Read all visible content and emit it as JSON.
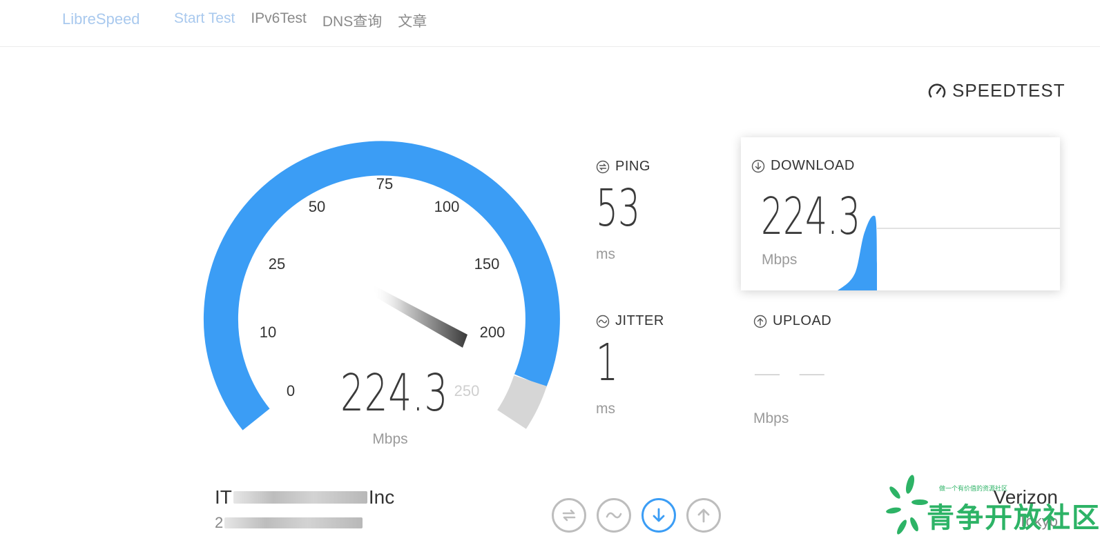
{
  "nav": {
    "brand": "LibreSpeed",
    "links": [
      "Start Test",
      "IPv6Test",
      "DNS查询",
      "文章"
    ]
  },
  "logo": {
    "text": "SPEEDTEST",
    "icon": "gauge-icon"
  },
  "gauge": {
    "value": "224.3",
    "unit": "Mbps",
    "scale_labels": [
      "0",
      "10",
      "25",
      "50",
      "75",
      "100",
      "150",
      "200",
      "250"
    ],
    "needle_at": "200",
    "arc_color": "#3b9df5",
    "remaining_color": "#d6d6d6"
  },
  "ping": {
    "label": "PING",
    "value": "53",
    "unit": "ms",
    "icon": "ping-icon"
  },
  "jitter": {
    "label": "JITTER",
    "value": "1",
    "unit": "ms",
    "icon": "jitter-icon"
  },
  "download": {
    "label": "DOWNLOAD",
    "value": "224.3",
    "unit": "Mbps",
    "icon": "download-arrow-icon"
  },
  "upload": {
    "label": "UPLOAD",
    "value": "— —",
    "unit": "Mbps",
    "icon": "upload-arrow-icon"
  },
  "isp": {
    "name_prefix": "IT",
    "name_suffix": "Inc",
    "ip_prefix": "2"
  },
  "controls": [
    {
      "name": "ping-control",
      "icon": "ping-icon",
      "active": false
    },
    {
      "name": "jitter-control",
      "icon": "jitter-icon",
      "active": false
    },
    {
      "name": "download-control",
      "icon": "download-arrow-icon",
      "active": true
    },
    {
      "name": "upload-control",
      "icon": "upload-arrow-icon",
      "active": false
    }
  ],
  "server": {
    "name": "Verizon",
    "location": "Tokyo"
  },
  "watermark": {
    "tagline": "做一个有价值的资源社区",
    "title": "青争开放社区",
    "color": "#2db366"
  },
  "accent_color": "#3b9df5"
}
